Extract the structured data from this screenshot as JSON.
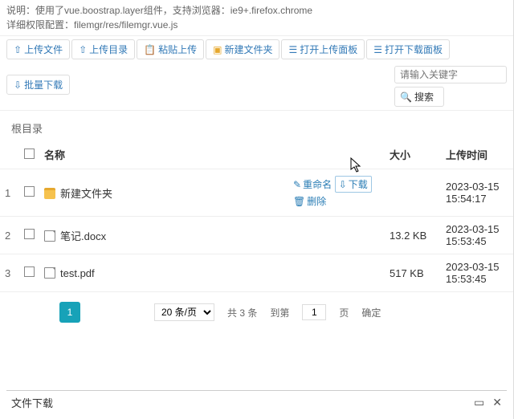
{
  "desc": {
    "line1": "说明：使用了vue.boostrap.layer组件，支持浏览器：ie9+.firefox.chrome",
    "line2": "详细权限配置：filemgr/res/filemgr.vue.js"
  },
  "toolbar": {
    "upload": "上传文件",
    "up_dir": "上传目录",
    "paste": "粘贴上传",
    "new_folder": "新建文件夹",
    "open_upload_panel": "打开上传面板",
    "open_download_panel": "打开下载面板",
    "batch_download": "批量下载"
  },
  "search": {
    "placeholder": "请输入关键字",
    "button": "搜索"
  },
  "breadcrumb": "根目录",
  "columns": {
    "name": "名称",
    "size": "大小",
    "time": "上传时间"
  },
  "row_actions": {
    "rename": "重命名",
    "download": "下载",
    "delete": "删除"
  },
  "rows": [
    {
      "idx": "1",
      "name": "新建文件夹",
      "icon": "folder",
      "size": "",
      "time": "2023-03-15 15:54:17",
      "show_actions": true
    },
    {
      "idx": "2",
      "name": "笔记.docx",
      "icon": "doc",
      "size": "13.2 KB",
      "time": "2023-03-15 15:53:45",
      "show_actions": false
    },
    {
      "idx": "3",
      "name": "test.pdf",
      "icon": "doc",
      "size": "517 KB",
      "time": "2023-03-15 15:53:45",
      "show_actions": false
    }
  ],
  "pager": {
    "current": "1",
    "size_label": "20 条/页",
    "total": "共 3 条",
    "goto": "到第",
    "page_input": "1",
    "page_unit": "页",
    "confirm": "确定"
  },
  "footer": {
    "title": "文件下载"
  }
}
